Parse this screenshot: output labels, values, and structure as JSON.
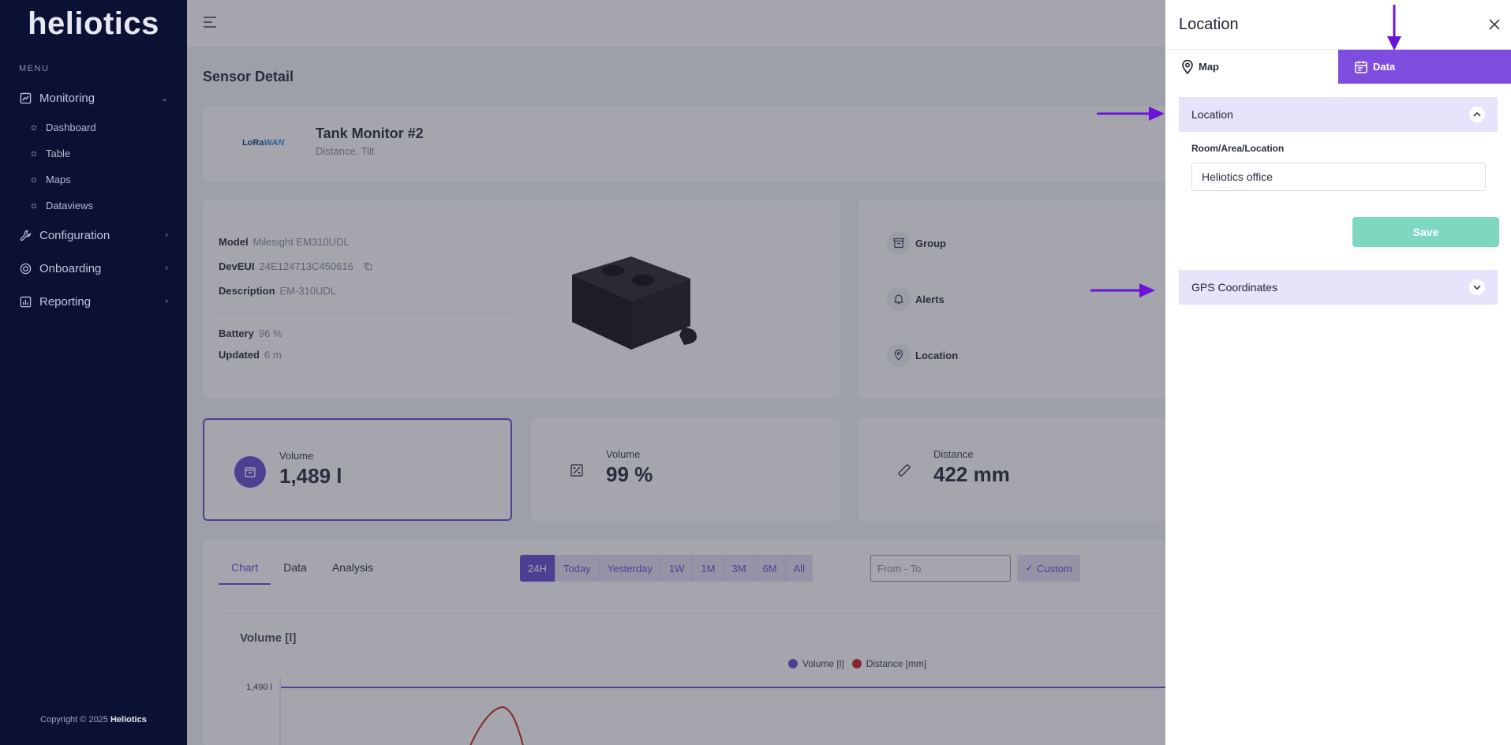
{
  "app": {
    "logo": "heliotics"
  },
  "sidebar": {
    "menu_label": "MENU",
    "items": [
      {
        "label": "Monitoring",
        "icon": "chart-box-icon",
        "expanded": true
      },
      {
        "label": "Configuration",
        "icon": "wrench-icon"
      },
      {
        "label": "Onboarding",
        "icon": "onboarding-icon"
      },
      {
        "label": "Reporting",
        "icon": "report-chart-icon"
      }
    ],
    "monitoring_sub": [
      "Dashboard",
      "Table",
      "Maps",
      "Dataviews"
    ],
    "copyright_prefix": "Copyright © 2025",
    "copyright_brand": "Heliotics"
  },
  "page": {
    "title": "Sensor Detail"
  },
  "device": {
    "logo_text_a": "LoRa",
    "logo_text_b": "WAN",
    "name": "Tank Monitor #2",
    "types": "Distance, Tilt",
    "model_label": "Model",
    "model": "Milesight EM310UDL",
    "deveui_label": "DevEUI",
    "deveui": "24E124713C450616",
    "description_label": "Description",
    "description": "EM-310UDL",
    "battery_label": "Battery",
    "battery": "96 %",
    "updated_label": "Updated",
    "updated": "6 m"
  },
  "side_panel": {
    "group": "Group",
    "alerts": "Alerts",
    "location": "Location"
  },
  "metrics": [
    {
      "label": "Volume",
      "value": "1,489 l",
      "icon": "box-icon"
    },
    {
      "label": "Volume",
      "value": "99 %",
      "icon": "percent-icon"
    },
    {
      "label": "Distance",
      "value": "422 mm",
      "icon": "ruler-icon"
    }
  ],
  "chart_section": {
    "tabs": [
      "Chart",
      "Data",
      "Analysis"
    ],
    "ranges": [
      "24H",
      "Today",
      "Yesterday",
      "1W",
      "1M",
      "3M",
      "6M",
      "All"
    ],
    "date_placeholder": "From - To",
    "custom_label": "Custom"
  },
  "chart_data": {
    "type": "line",
    "title": "Volume [l]",
    "series": [
      {
        "name": "Volume [l]",
        "color": "#6b4fd3"
      },
      {
        "name": "Distance [mm]",
        "color": "#c9252b"
      }
    ],
    "y_tick_label": "1,490 l"
  },
  "drawer": {
    "title": "Location",
    "tabs": [
      {
        "label": "Map",
        "icon": "map-pin-icon"
      },
      {
        "label": "Data",
        "icon": "calendar-icon"
      }
    ],
    "location_section": "Location",
    "field_label": "Room/Area/Location",
    "field_value": "Heliotics office",
    "save_label": "Save",
    "gps_section": "GPS Coordinates"
  },
  "colors": {
    "accent": "#7c4ddf",
    "sidebar": "#0b1133",
    "save": "#7dd8bf",
    "arrow": "#6a14d6"
  }
}
